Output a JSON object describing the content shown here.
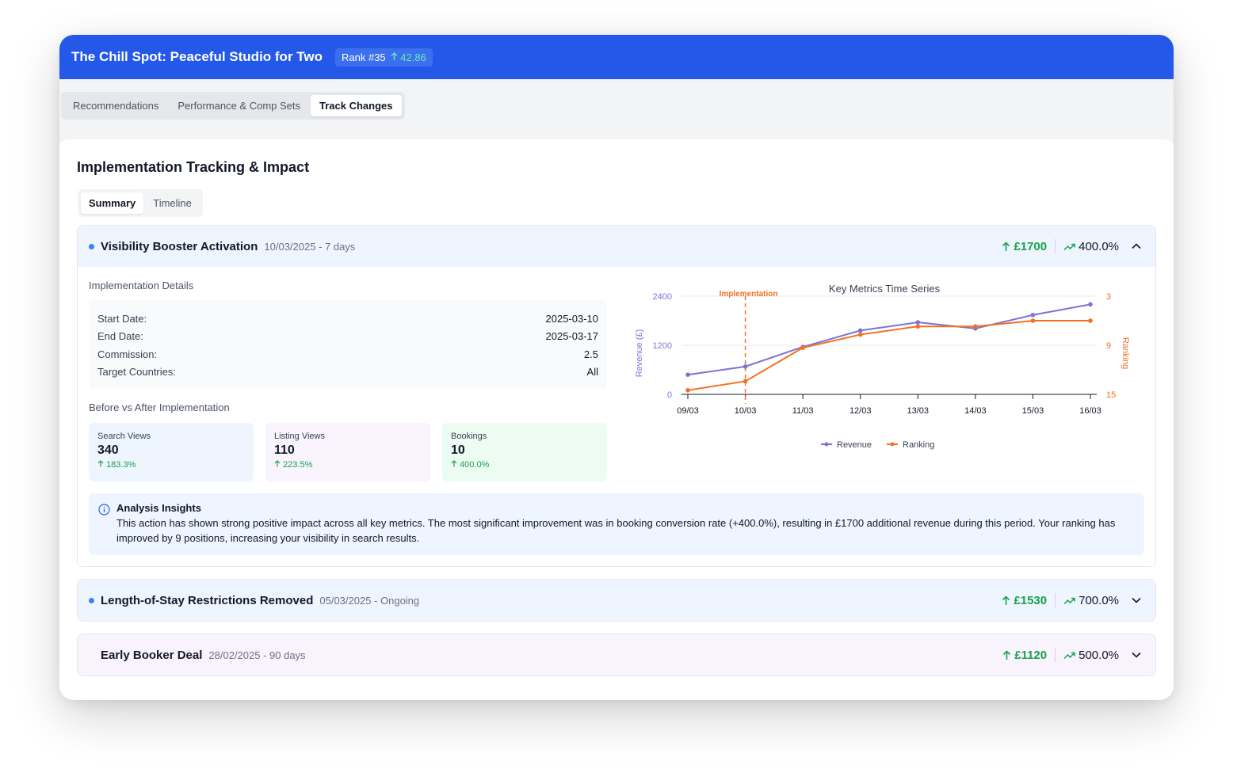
{
  "header": {
    "title": "The Chill Spot: Peaceful Studio for Two",
    "rank_label": "Rank #35",
    "rank_delta": "42.86"
  },
  "tabs": [
    {
      "label": "Recommendations"
    },
    {
      "label": "Performance & Comp Sets"
    },
    {
      "label": "Track Changes"
    }
  ],
  "panel": {
    "title": "Implementation Tracking & Impact",
    "subtabs": [
      {
        "label": "Summary"
      },
      {
        "label": "Timeline"
      }
    ]
  },
  "items": [
    {
      "title": "Visibility Booster Activation",
      "date": "10/03/2025 - 7 days",
      "revenue": "£1700",
      "percent": "400.0%",
      "expanded": true,
      "details_label": "Implementation Details",
      "details": [
        {
          "key": "Start Date:",
          "value": "2025-03-10"
        },
        {
          "key": "End Date:",
          "value": "2025-03-17"
        },
        {
          "key": "Commission:",
          "value": "2.5"
        },
        {
          "key": "Target Countries:",
          "value": "All"
        }
      ],
      "compare_label": "Before vs After Implementation",
      "metrics": [
        {
          "label": "Search Views",
          "value": "340",
          "delta": "183.3%",
          "bg": "#eff5ff"
        },
        {
          "label": "Listing Views",
          "value": "110",
          "delta": "223.5%",
          "bg": "#f8f3fd"
        },
        {
          "label": "Bookings",
          "value": "10",
          "delta": "400.0%",
          "bg": "#edfcf2"
        }
      ],
      "insights": {
        "title": "Analysis Insights",
        "text": "This action has shown strong positive impact across all key metrics. The most significant improvement was in booking conversion rate (+400.0%), resulting in £1700 additional revenue during this period. Your ranking has improved by 9 positions, increasing your visibility in search results."
      }
    },
    {
      "title": "Length-of-Stay Restrictions Removed",
      "date": "05/03/2025 - Ongoing",
      "revenue": "£1530",
      "percent": "700.0%",
      "expanded": false
    },
    {
      "title": "Early Booker Deal",
      "date": "28/02/2025 - 90 days",
      "revenue": "£1120",
      "percent": "500.0%",
      "expanded": false
    }
  ],
  "chart_data": {
    "type": "line",
    "title": "Key Metrics Time Series",
    "annotation": "Implementation",
    "annotation_x": "10/03",
    "categories": [
      "09/03",
      "10/03",
      "11/03",
      "12/03",
      "13/03",
      "14/03",
      "15/03",
      "16/03"
    ],
    "series": [
      {
        "name": "Revenue",
        "axis": "left",
        "color": "#7b74d4",
        "values": [
          480,
          680,
          1160,
          1560,
          1760,
          1610,
          1940,
          2200
        ]
      },
      {
        "name": "Ranking",
        "axis": "right",
        "color": "#f37021",
        "values": [
          14.5,
          13.4,
          9.3,
          7.7,
          6.7,
          6.7,
          6,
          6
        ]
      }
    ],
    "ylabel": "Revenue (£)",
    "ylabel_right": "Ranking",
    "ylim": [
      0,
      2400
    ],
    "yticks": [
      "0",
      "1200",
      "2400"
    ],
    "ylim_right": [
      15,
      3
    ],
    "yticks_right": [
      "15",
      "9",
      "3"
    ],
    "grid": true,
    "legend": "bottom"
  },
  "colors": {
    "header_bg": "#2458e9",
    "accent_blue": "#3b82f6",
    "positive": "#16a34a",
    "revenue": "#7b74d4",
    "ranking": "#f37021"
  },
  "icons": {
    "revenue_arrow": "arrow-up-icon",
    "trend": "trending-up-icon",
    "collapse": "chevron-up-icon",
    "expand": "chevron-down-icon",
    "info": "info-icon"
  }
}
